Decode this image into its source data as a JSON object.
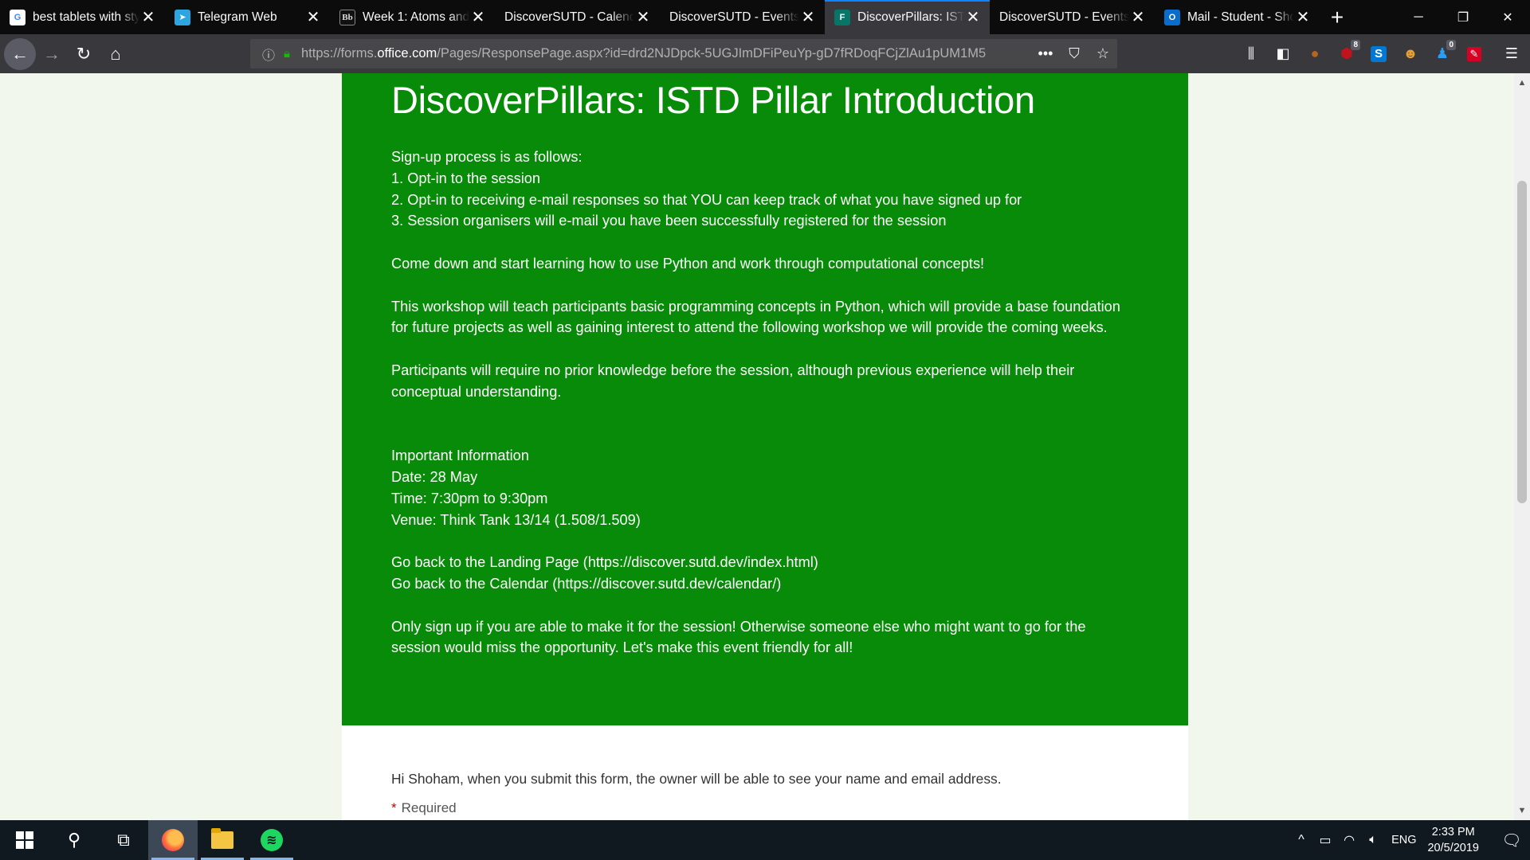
{
  "browser": {
    "tabs": [
      {
        "title": "best tablets with stylus",
        "favicon": "google-icon",
        "active": false
      },
      {
        "title": "Telegram Web",
        "favicon": "telegram-icon",
        "active": false
      },
      {
        "title": "Week 1: Atoms and",
        "favicon": "blackboard-icon",
        "active": false
      },
      {
        "title": "DiscoverSUTD - Calendar",
        "favicon": "",
        "active": false
      },
      {
        "title": "DiscoverSUTD - Events",
        "favicon": "",
        "active": false
      },
      {
        "title": "DiscoverPillars: ISTD",
        "favicon": "forms-icon",
        "active": true
      },
      {
        "title": "DiscoverSUTD - Events",
        "favicon": "",
        "active": false
      },
      {
        "title": "Mail - Student - Shoham",
        "favicon": "outlook-icon",
        "active": false
      }
    ],
    "favicon_text": {
      "google": "G",
      "telegram": "➤",
      "blackboard": "Bb",
      "forms": "F",
      "outlook": "O"
    },
    "url_prefix": "https://forms.",
    "url_domain": "office.com",
    "url_rest": "/Pages/ResponsePage.aspx?id=drd2NJDpck-5UGJImDFiPeuYp-gD7fRDoqFCjZlAu1pUM1M5",
    "badges": {
      "ublock": "8",
      "notify": "0"
    }
  },
  "form": {
    "title": "DiscoverPillars: ISTD Pillar Introduction",
    "description": [
      "Sign-up process is as follows:\n1. Opt-in to the session\n2. Opt-in to receiving e-mail responses so that YOU can keep track of what you have signed up for\n3. Session organisers will e-mail you have been successfully registered for the session",
      "",
      "Come down and start learning how to use Python and work through computational concepts!",
      "",
      "This workshop will teach participants basic programming concepts in Python, which will provide a base foundation for future projects as well as gaining interest to attend the following workshop we will provide the coming weeks.",
      "",
      "Participants will require no prior knowledge before the session, although previous experience will help their conceptual understanding.",
      "",
      "",
      "Important Information\nDate: 28 May\nTime: 7:30pm to 9:30pm\nVenue: Think Tank 13/14 (1.508/1.509)",
      "",
      "Go back to the Landing Page (https://discover.sutd.dev/index.html)\nGo back to the Calendar (https://discover.sutd.dev/calendar/)",
      "",
      "Only sign up if you are able to make it for the session! Otherwise someone else who might want to go for the session would miss the opportunity. Let's make this event friendly for all!"
    ],
    "notice": "Hi Shoham, when you submit this form, the owner will be able to see your name and email address.",
    "required_label": "Required",
    "colors": {
      "banner": "#078b08",
      "page_bg": "#f2f7ee"
    }
  },
  "taskbar": {
    "lang": "ENG",
    "time": "2:33 PM",
    "date": "20/5/2019"
  }
}
